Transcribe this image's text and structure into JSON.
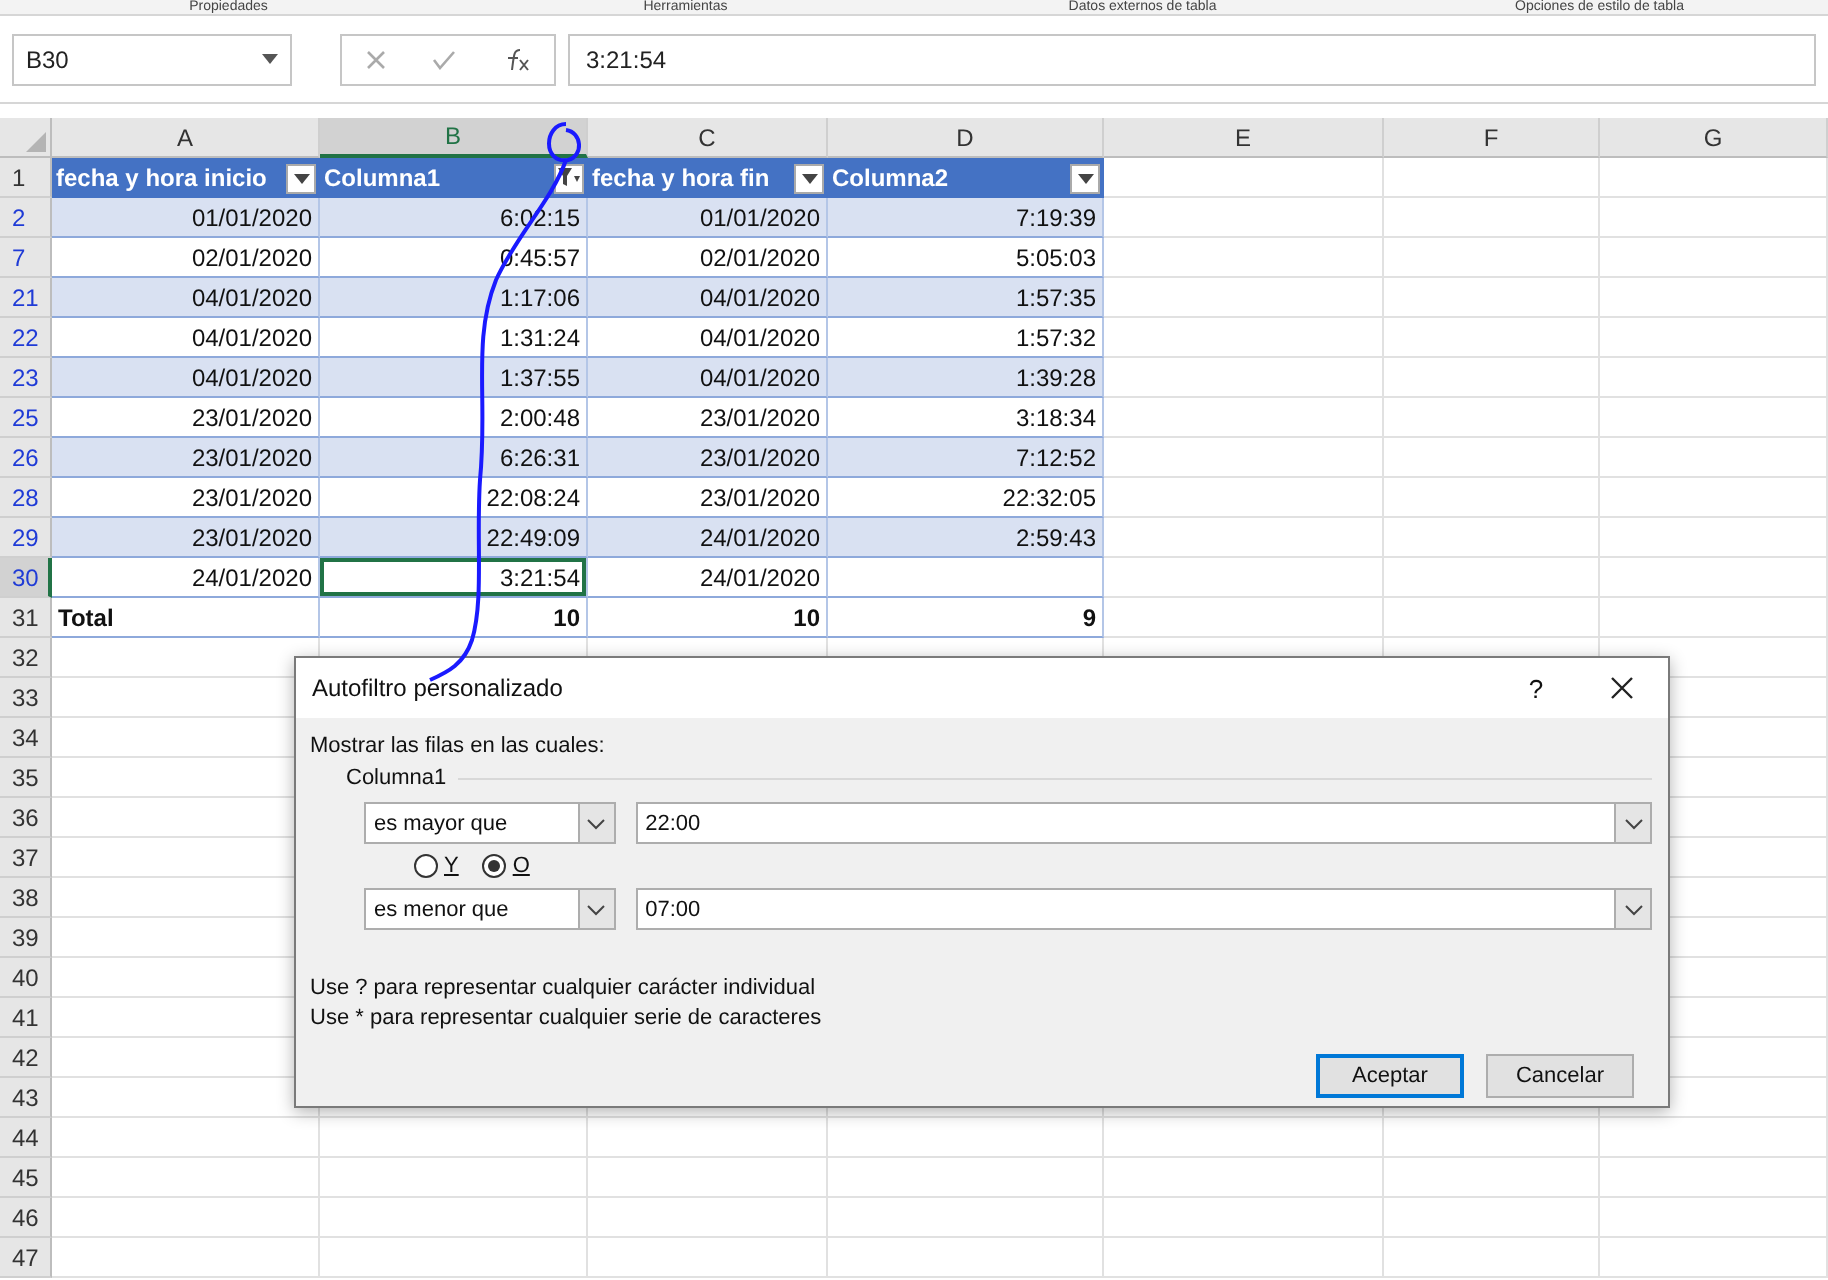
{
  "ribbon_groups": [
    "Propiedades",
    "Herramientas",
    "Datos externos de tabla",
    "Opciones de estilo de tabla"
  ],
  "formula_bar": {
    "name_box": "B30",
    "value": "3:21:54"
  },
  "columns": [
    {
      "label": "A",
      "selected": false
    },
    {
      "label": "B",
      "selected": true
    },
    {
      "label": "C",
      "selected": false
    },
    {
      "label": "D",
      "selected": false
    },
    {
      "label": "E",
      "selected": false
    },
    {
      "label": "F",
      "selected": false
    },
    {
      "label": "G",
      "selected": false
    }
  ],
  "table": {
    "header_row": "1",
    "headers": [
      {
        "label": "fecha y hora inicio",
        "filter_active": false
      },
      {
        "label": "Columna1",
        "filter_active": true
      },
      {
        "label": "fecha y hora fin",
        "filter_active": false
      },
      {
        "label": "Columna2",
        "filter_active": false
      }
    ],
    "rows": [
      {
        "row": "2",
        "selected": false,
        "cells": [
          "01/01/2020",
          "6:02:15",
          "01/01/2020",
          "7:19:39"
        ]
      },
      {
        "row": "7",
        "selected": false,
        "cells": [
          "02/01/2020",
          "0:45:57",
          "02/01/2020",
          "5:05:03"
        ]
      },
      {
        "row": "21",
        "selected": false,
        "cells": [
          "04/01/2020",
          "1:17:06",
          "04/01/2020",
          "1:57:35"
        ]
      },
      {
        "row": "22",
        "selected": false,
        "cells": [
          "04/01/2020",
          "1:31:24",
          "04/01/2020",
          "1:57:32"
        ]
      },
      {
        "row": "23",
        "selected": false,
        "cells": [
          "04/01/2020",
          "1:37:55",
          "04/01/2020",
          "1:39:28"
        ]
      },
      {
        "row": "25",
        "selected": false,
        "cells": [
          "23/01/2020",
          "2:00:48",
          "23/01/2020",
          "3:18:34"
        ]
      },
      {
        "row": "26",
        "selected": false,
        "cells": [
          "23/01/2020",
          "6:26:31",
          "23/01/2020",
          "7:12:52"
        ]
      },
      {
        "row": "28",
        "selected": false,
        "cells": [
          "23/01/2020",
          "22:08:24",
          "23/01/2020",
          "22:32:05"
        ]
      },
      {
        "row": "29",
        "selected": false,
        "cells": [
          "23/01/2020",
          "22:49:09",
          "24/01/2020",
          "2:59:43"
        ]
      },
      {
        "row": "30",
        "selected": true,
        "cells": [
          "24/01/2020",
          "3:21:54",
          "24/01/2020",
          ""
        ]
      }
    ],
    "total_row": {
      "row": "31",
      "cells": [
        "Total",
        "10",
        "10",
        "9"
      ]
    }
  },
  "empty_rows": [
    "32",
    "33",
    "34",
    "35",
    "36",
    "37",
    "38",
    "39",
    "40",
    "41",
    "42",
    "43",
    "44",
    "45",
    "46",
    "47"
  ],
  "dialog": {
    "title": "Autofiltro personalizado",
    "help": "?",
    "prompt": "Mostrar las filas en las cuales:",
    "group_label": "Columna1",
    "conditions": [
      {
        "operator": "es mayor que",
        "value": "22:00"
      },
      {
        "operator": "es menor que",
        "value": "07:00"
      }
    ],
    "logic": [
      {
        "label": "Y",
        "selected": false
      },
      {
        "label": "O",
        "selected": true
      }
    ],
    "hints": [
      "Use ? para representar cualquier carácter individual",
      "Use * para representar cualquier serie de caracteres"
    ],
    "buttons": [
      {
        "label": "Aceptar",
        "default": true
      },
      {
        "label": "Cancelar",
        "default": false
      }
    ]
  }
}
